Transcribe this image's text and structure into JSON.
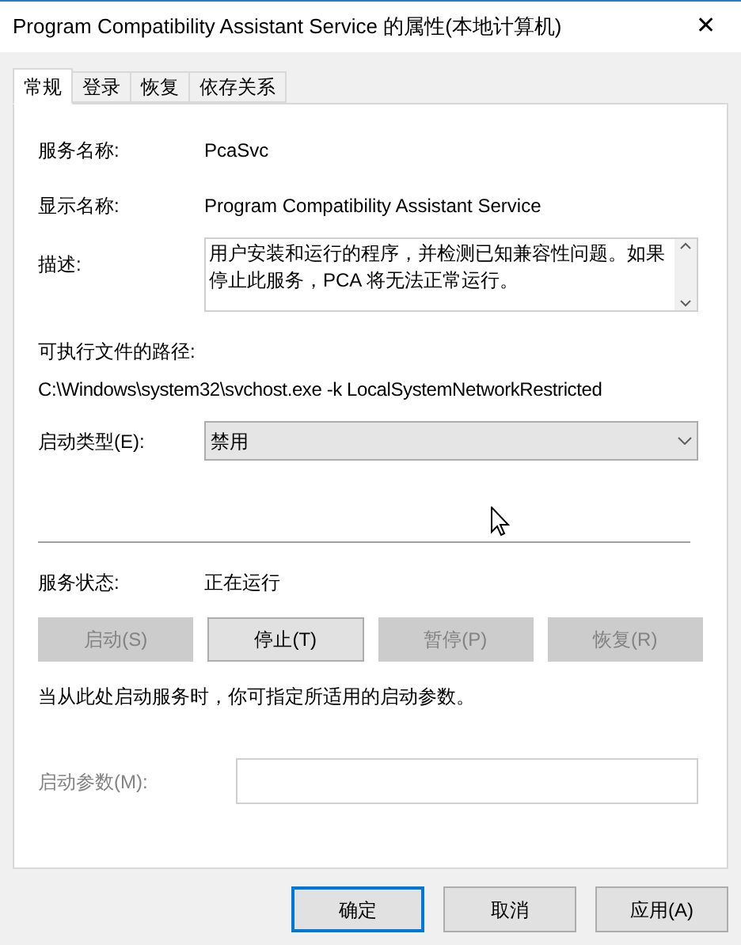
{
  "window": {
    "title": "Program Compatibility Assistant Service 的属性(本地计算机)",
    "close": "✕"
  },
  "tabs": [
    {
      "label": "常规",
      "selected": true
    },
    {
      "label": "登录",
      "selected": false
    },
    {
      "label": "恢复",
      "selected": false
    },
    {
      "label": "依存关系",
      "selected": false
    }
  ],
  "general": {
    "service_name": {
      "label": "服务名称:",
      "value": "PcaSvc"
    },
    "display_name": {
      "label": "显示名称:",
      "value": "Program Compatibility Assistant Service"
    },
    "description": {
      "label": "描述:",
      "value": "用户安装和运行的程序，并检测已知兼容性问题。如果停止此服务，PCA 将无法正常运行。"
    },
    "path": {
      "label": "可执行文件的路径:",
      "value": "C:\\Windows\\system32\\svchost.exe -k LocalSystemNetworkRestricted"
    },
    "startup_type": {
      "label": "启动类型(E):",
      "value": "禁用"
    },
    "status": {
      "label": "服务状态:",
      "value": "正在运行"
    },
    "control_buttons": [
      {
        "label": "启动(S)",
        "disabled": true
      },
      {
        "label": "停止(T)",
        "disabled": false
      },
      {
        "label": "暂停(P)",
        "disabled": true
      },
      {
        "label": "恢复(R)",
        "disabled": true
      }
    ],
    "hint": "当从此处启动服务时，你可指定所适用的启动参数。",
    "start_parameters": {
      "label": "启动参数(M):",
      "disabled": true
    }
  },
  "buttons": [
    {
      "label": "确定",
      "default": true
    },
    {
      "label": "取消",
      "default": false
    },
    {
      "label": "应用(A)",
      "default": false
    }
  ]
}
